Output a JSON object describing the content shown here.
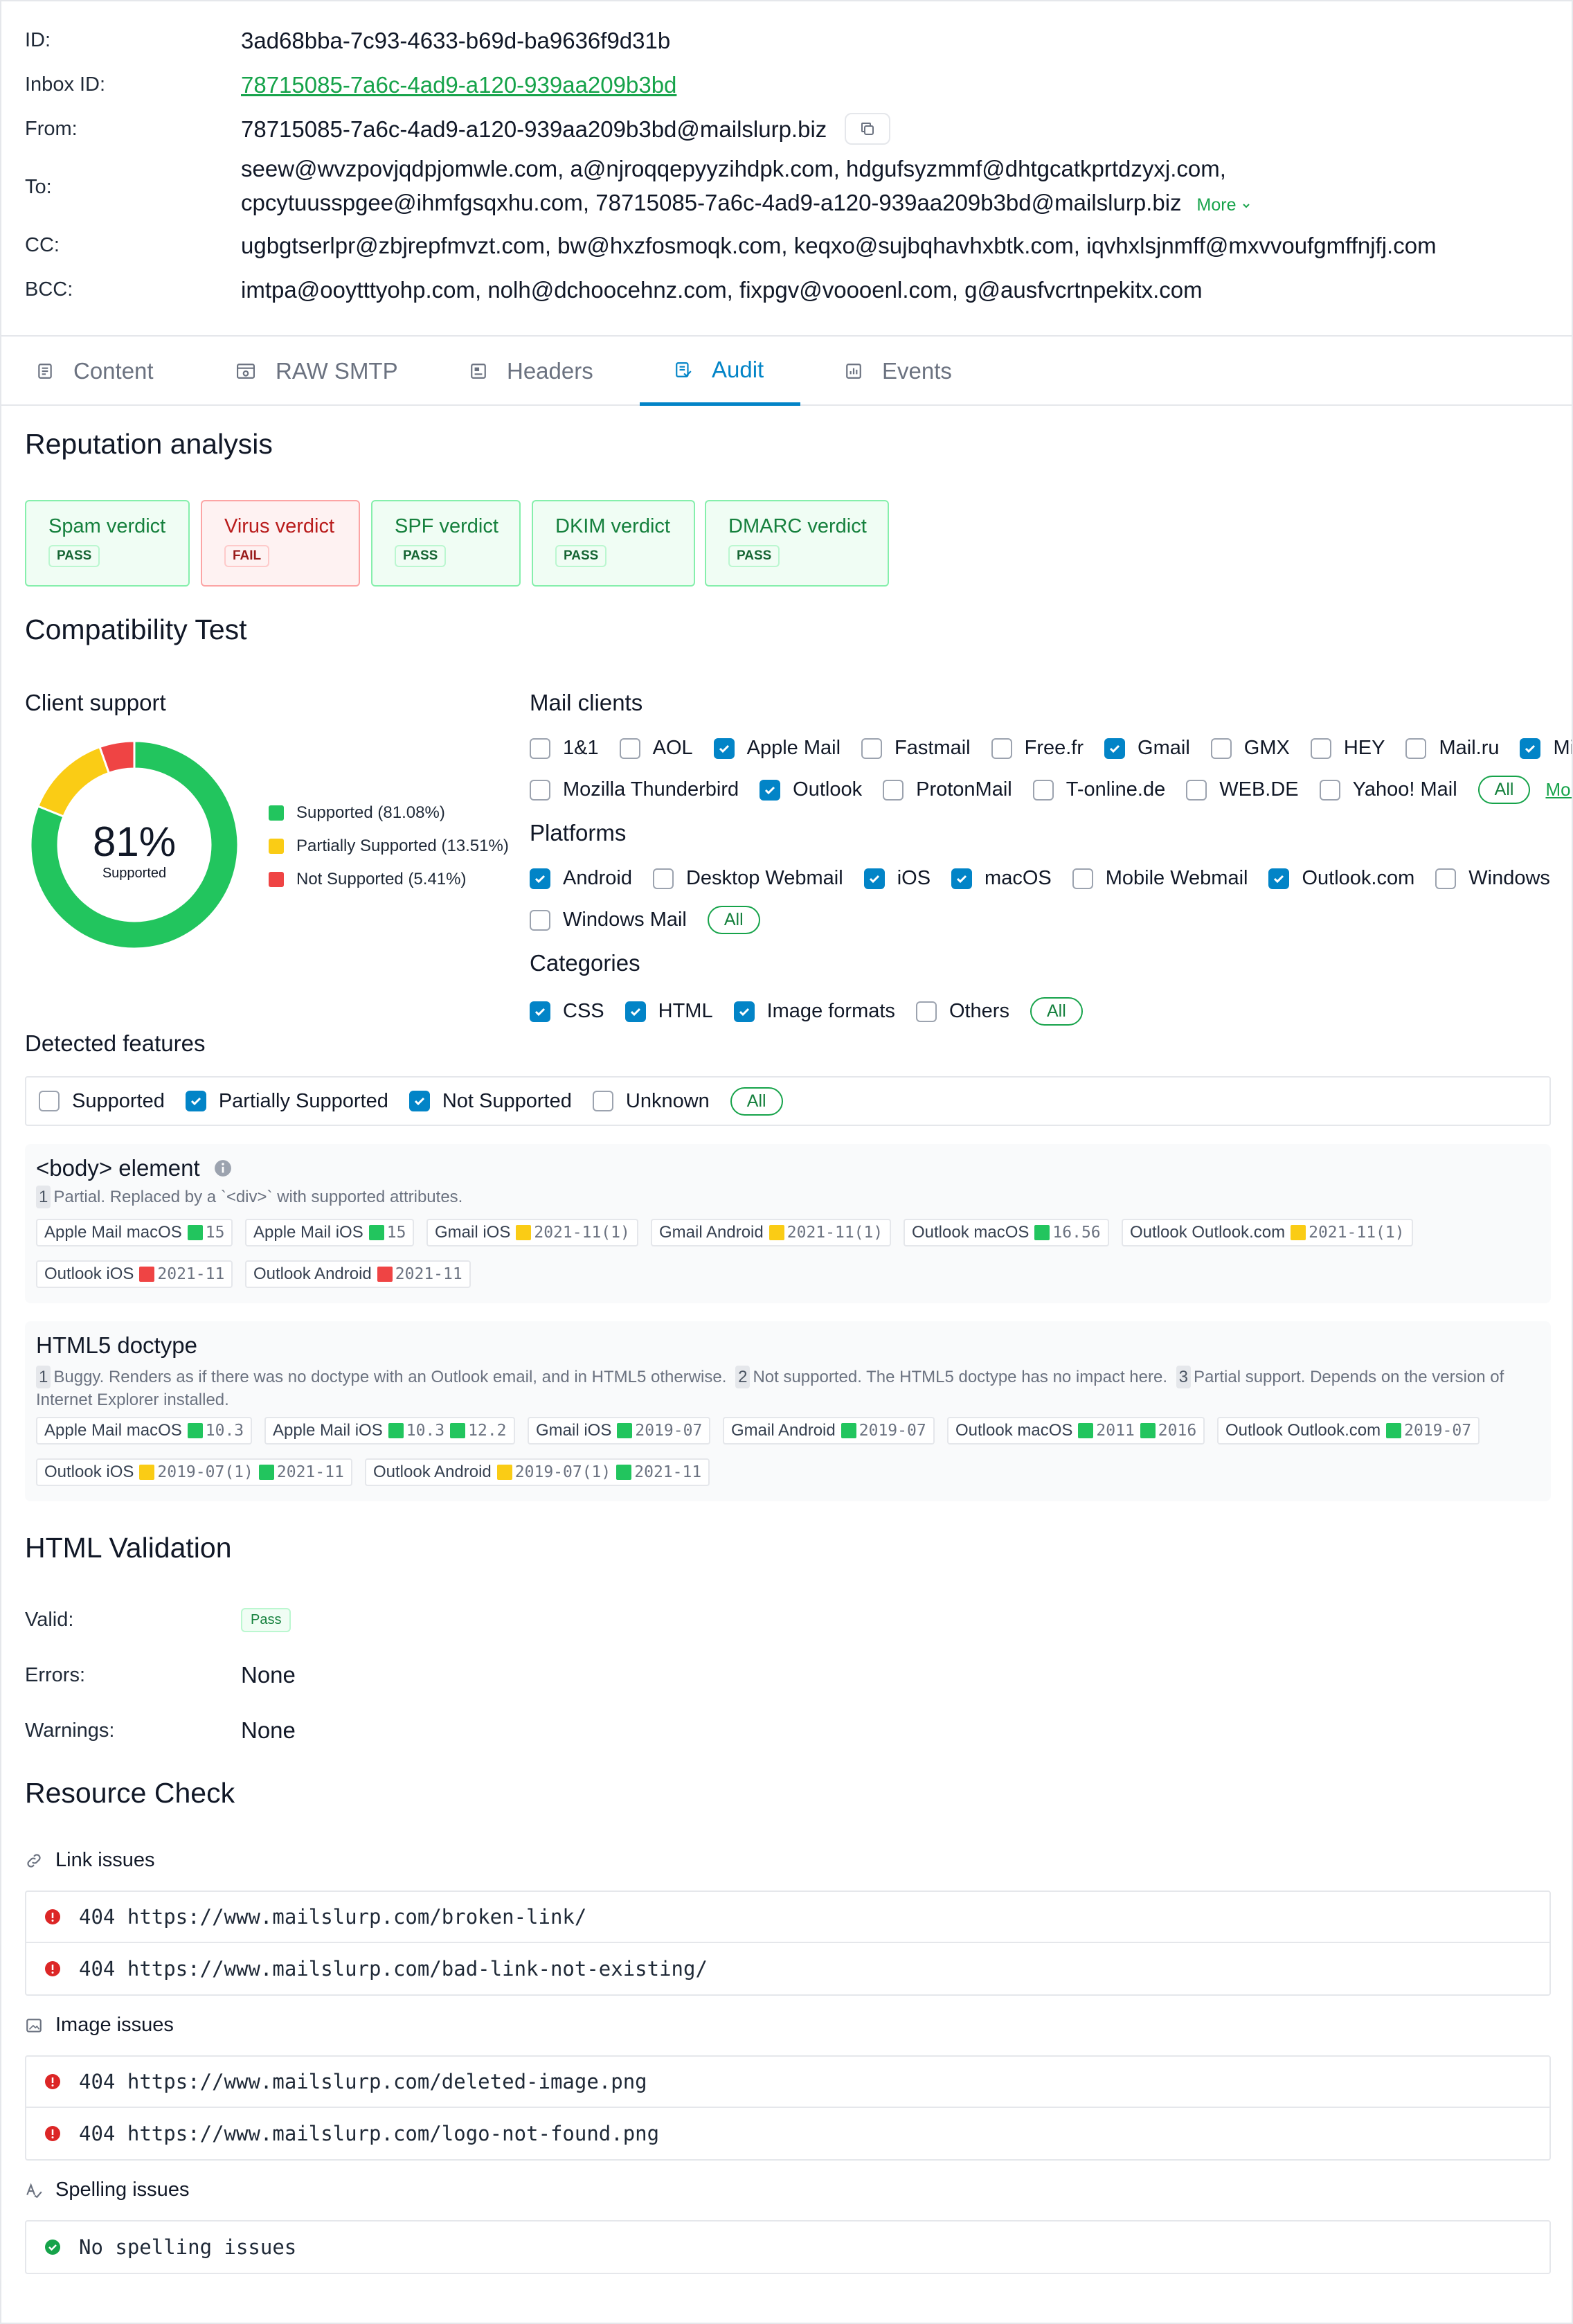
{
  "meta": {
    "id_label": "ID:",
    "id": "3ad68bba-7c93-4633-b69d-ba9636f9d31b",
    "inbox_label": "Inbox ID:",
    "inbox_id": "78715085-7a6c-4ad9-a120-939aa209b3bd",
    "from_label": "From:",
    "from": "78715085-7a6c-4ad9-a120-939aa209b3bd@mailslurp.biz",
    "to_label": "To:",
    "to_line1": "seew@wvzpovjqdpjomwle.com, a@njroqqepyyzihdpk.com, hdgufsyzmmf@dhtgcatkprtdzyxj.com,",
    "to_line2": "cpcytuusspgee@ihmfgsqxhu.com, 78715085-7a6c-4ad9-a120-939aa209b3bd@mailslurp.biz",
    "to_more": "More",
    "cc_label": "CC:",
    "cc": "ugbgtserlpr@zbjrepfmvzt.com, bw@hxzfosmoqk.com, keqxo@sujbqhavhxbtk.com, iqvhxlsjnmff@mxvvoufgmffnjfj.com",
    "bcc_label": "BCC:",
    "bcc": "imtpa@ooytttyohp.com, nolh@dchoocehnz.com, fixpgv@voooenl.com, g@ausfvcrtnpekitx.com"
  },
  "tabs": [
    {
      "label": "Content",
      "icon": "document-icon"
    },
    {
      "label": "RAW SMTP",
      "icon": "terminal-icon"
    },
    {
      "label": "Headers",
      "icon": "headers-icon"
    },
    {
      "label": "Audit",
      "icon": "audit-icon",
      "active": true
    },
    {
      "label": "Events",
      "icon": "chart-icon"
    }
  ],
  "reputation": {
    "title": "Reputation analysis",
    "verdicts": [
      {
        "name": "Spam verdict",
        "status": "PASS"
      },
      {
        "name": "Virus verdict",
        "status": "FAIL"
      },
      {
        "name": "SPF verdict",
        "status": "PASS"
      },
      {
        "name": "DKIM verdict",
        "status": "PASS"
      },
      {
        "name": "DMARC verdict",
        "status": "PASS"
      }
    ]
  },
  "compat": {
    "title": "Compatibility Test",
    "client_support_title": "Client support",
    "center_value": "81%",
    "center_label": "Supported",
    "legend": [
      {
        "label": "Supported (81.08%)",
        "value": 81.08,
        "color": "#22c55e"
      },
      {
        "label": "Partially Supported (13.51%)",
        "value": 13.51,
        "color": "#facc15"
      },
      {
        "label": "Not Supported (5.41%)",
        "value": 5.41,
        "color": "#ef4444"
      }
    ],
    "mail_clients_title": "Mail clients",
    "mail_clients_row1": [
      {
        "label": "1&1",
        "checked": false
      },
      {
        "label": "AOL",
        "checked": false
      },
      {
        "label": "Apple Mail",
        "checked": true
      },
      {
        "label": "Fastmail",
        "checked": false
      },
      {
        "label": "Free.fr",
        "checked": false
      },
      {
        "label": "Gmail",
        "checked": true
      },
      {
        "label": "GMX",
        "checked": false
      },
      {
        "label": "HEY",
        "checked": false
      },
      {
        "label": "Mail.ru",
        "checked": false
      },
      {
        "label": "Microsoft",
        "checked": true
      }
    ],
    "mail_clients_row2": [
      {
        "label": "Mozilla Thunderbird",
        "checked": false
      },
      {
        "label": "Outlook",
        "checked": true
      },
      {
        "label": "ProtonMail",
        "checked": false
      },
      {
        "label": "T-online.de",
        "checked": false
      },
      {
        "label": "WEB.DE",
        "checked": false
      },
      {
        "label": "Yahoo! Mail",
        "checked": false
      }
    ],
    "all_label": "All",
    "more_label": "More",
    "platforms_title": "Platforms",
    "platforms_row1": [
      {
        "label": "Android",
        "checked": true
      },
      {
        "label": "Desktop Webmail",
        "checked": false
      },
      {
        "label": "iOS",
        "checked": true
      },
      {
        "label": "macOS",
        "checked": true
      },
      {
        "label": "Mobile Webmail",
        "checked": false
      },
      {
        "label": "Outlook.com",
        "checked": true
      },
      {
        "label": "Windows",
        "checked": false
      }
    ],
    "platforms_row2": [
      {
        "label": "Windows Mail",
        "checked": false
      }
    ],
    "categories_title": "Categories",
    "categories": [
      {
        "label": "CSS",
        "checked": true
      },
      {
        "label": "HTML",
        "checked": true
      },
      {
        "label": "Image formats",
        "checked": true
      },
      {
        "label": "Others",
        "checked": false
      }
    ],
    "detected_title": "Detected features",
    "detected_filters": [
      {
        "label": "Supported",
        "checked": false
      },
      {
        "label": "Partially Supported",
        "checked": true
      },
      {
        "label": "Not Supported",
        "checked": true
      },
      {
        "label": "Unknown",
        "checked": false
      }
    ],
    "features": [
      {
        "title": "<body> element",
        "notes": [
          {
            "n": "1",
            "text": "Partial. Replaced by a `<div>` with supported attributes."
          }
        ],
        "chips": [
          {
            "client": "Apple Mail macOS",
            "marks": [
              {
                "s": "g",
                "v": "15"
              }
            ]
          },
          {
            "client": "Apple Mail iOS",
            "marks": [
              {
                "s": "g",
                "v": "15"
              }
            ]
          },
          {
            "client": "Gmail iOS",
            "marks": [
              {
                "s": "y",
                "v": "2021-11(1)"
              }
            ]
          },
          {
            "client": "Gmail Android",
            "marks": [
              {
                "s": "y",
                "v": "2021-11(1)"
              }
            ]
          },
          {
            "client": "Outlook macOS",
            "marks": [
              {
                "s": "g",
                "v": "16.56"
              }
            ]
          },
          {
            "client": "Outlook Outlook.com",
            "marks": [
              {
                "s": "y",
                "v": "2021-11(1)"
              }
            ]
          },
          {
            "client": "Outlook iOS",
            "marks": [
              {
                "s": "r",
                "v": "2021-11"
              }
            ]
          },
          {
            "client": "Outlook Android",
            "marks": [
              {
                "s": "r",
                "v": "2021-11"
              }
            ]
          }
        ]
      },
      {
        "title": "HTML5 doctype",
        "notes": [
          {
            "n": "1",
            "text": "Buggy. Renders as if there was no doctype with an Outlook email, and in HTML5 otherwise."
          },
          {
            "n": "2",
            "text": "Not supported. The HTML5 doctype has no impact here."
          },
          {
            "n": "3",
            "text": "Partial support. Depends on the version of Internet Explorer installed."
          }
        ],
        "chips": [
          {
            "client": "Apple Mail macOS",
            "marks": [
              {
                "s": "g",
                "v": "10.3"
              }
            ]
          },
          {
            "client": "Apple Mail iOS",
            "marks": [
              {
                "s": "g",
                "v": "10.3"
              },
              {
                "s": "g",
                "v": "12.2"
              }
            ]
          },
          {
            "client": "Gmail iOS",
            "marks": [
              {
                "s": "g",
                "v": "2019-07"
              }
            ]
          },
          {
            "client": "Gmail Android",
            "marks": [
              {
                "s": "g",
                "v": "2019-07"
              }
            ]
          },
          {
            "client": "Outlook macOS",
            "marks": [
              {
                "s": "g",
                "v": "2011"
              },
              {
                "s": "g",
                "v": "2016"
              }
            ]
          },
          {
            "client": "Outlook Outlook.com",
            "marks": [
              {
                "s": "g",
                "v": "2019-07"
              }
            ]
          },
          {
            "client": "Outlook iOS",
            "marks": [
              {
                "s": "y",
                "v": "2019-07(1)"
              },
              {
                "s": "g",
                "v": "2021-11"
              }
            ]
          },
          {
            "client": "Outlook Android",
            "marks": [
              {
                "s": "y",
                "v": "2019-07(1)"
              },
              {
                "s": "g",
                "v": "2021-11"
              }
            ]
          }
        ]
      }
    ]
  },
  "validation": {
    "title": "HTML Validation",
    "valid_label": "Valid:",
    "valid_value": "Pass",
    "errors_label": "Errors:",
    "errors_value": "None",
    "warnings_label": "Warnings:",
    "warnings_value": "None"
  },
  "resources": {
    "title": "Resource Check",
    "link_title": "Link issues",
    "links": [
      {
        "code": "404",
        "url": "https://www.mailslurp.com/broken-link/"
      },
      {
        "code": "404",
        "url": "https://www.mailslurp.com/bad-link-not-existing/"
      }
    ],
    "image_title": "Image issues",
    "images": [
      {
        "code": "404",
        "url": "https://www.mailslurp.com/deleted-image.png"
      },
      {
        "code": "404",
        "url": "https://www.mailslurp.com/logo-not-found.png"
      }
    ],
    "spelling_title": "Spelling issues",
    "spelling_message": "No spelling issues"
  }
}
